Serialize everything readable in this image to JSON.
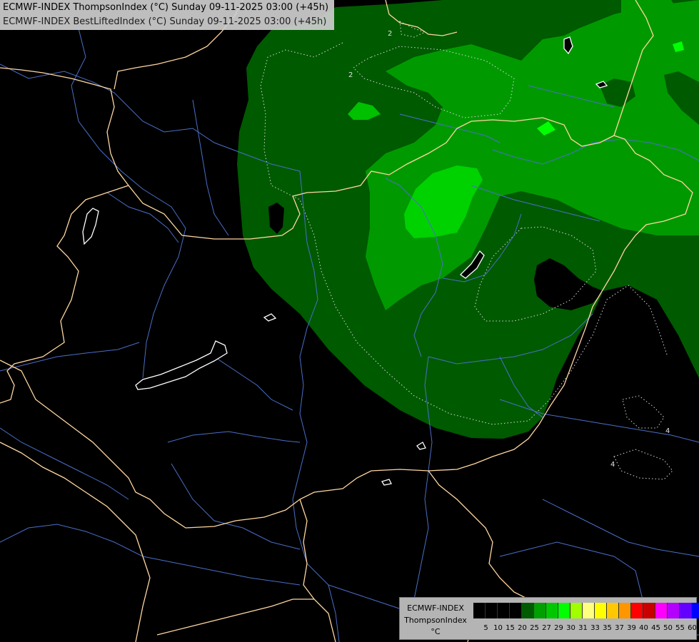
{
  "header": {
    "line1": "ECMWF-INDEX ThompsonIndex (°C) Sunday 09-11-2025 03:00 (+45h)",
    "line2": "ECMWF-INDEX BestLiftedIndex (°C) Sunday 09-11-2025 03:00 (+45h)"
  },
  "legend": {
    "model": "ECMWF-INDEX",
    "parameter": "ThompsonIndex",
    "unit": "°C",
    "ticks": [
      "5",
      "10",
      "15",
      "20",
      "25",
      "27",
      "29",
      "30",
      "31",
      "33",
      "35",
      "37",
      "39",
      "40",
      "45",
      "50",
      "55",
      "60"
    ],
    "colors": [
      "#000000",
      "#000000",
      "#000000",
      "#000000",
      "#005a00",
      "#00a000",
      "#00c800",
      "#00ff00",
      "#a0ff00",
      "#ffff80",
      "#ffff00",
      "#ffc800",
      "#ff9600",
      "#ff0000",
      "#c80000",
      "#ff00ff",
      "#b400ff",
      "#6400ff",
      "#0000ff"
    ]
  },
  "map": {
    "contour_labels": [
      "2",
      "2",
      "4",
      "4"
    ],
    "colors": {
      "background": "#000000",
      "dark_green": "#005a00",
      "mid_green": "#009400",
      "light_green": "#00c800",
      "bright_green": "#00ff00",
      "borders": "#ffd7a0",
      "rivers": "#4a6ec8",
      "lakes": "#ffffff",
      "contours": "#d0d0d0"
    }
  }
}
